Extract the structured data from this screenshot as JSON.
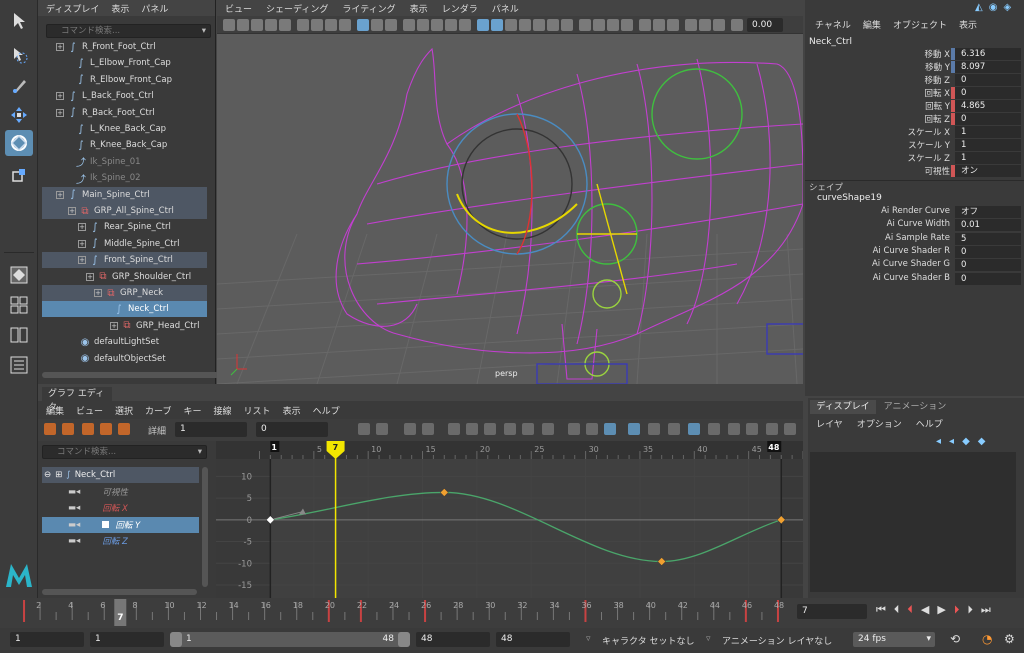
{
  "outliner": {
    "menu": [
      "ディスプレイ",
      "表示",
      "パネル"
    ],
    "search_placeholder": "コマンド検索...",
    "items": [
      {
        "label": "R_Front_Foot_Ctrl"
      },
      {
        "label": "L_Elbow_Front_Cap"
      },
      {
        "label": "R_Elbow_Front_Cap"
      },
      {
        "label": "L_Back_Foot_Ctrl"
      },
      {
        "label": "R_Back_Foot_Ctrl"
      },
      {
        "label": "L_Knee_Back_Cap"
      },
      {
        "label": "R_Knee_Back_Cap"
      },
      {
        "label": "Ik_Spine_01"
      },
      {
        "label": "Ik_Spine_02"
      },
      {
        "label": "Main_Spine_Ctrl"
      },
      {
        "label": "GRP_All_Spine_Ctrl"
      },
      {
        "label": "Rear_Spine_Ctrl"
      },
      {
        "label": "Middle_Spine_Ctrl"
      },
      {
        "label": "Front_Spine_Ctrl"
      },
      {
        "label": "GRP_Shoulder_Ctrl"
      },
      {
        "label": "GRP_Neck"
      },
      {
        "label": "Neck_Ctrl"
      },
      {
        "label": "GRP_Head_Ctrl"
      },
      {
        "label": "defaultLightSet"
      },
      {
        "label": "defaultObjectSet"
      }
    ]
  },
  "viewport": {
    "menu": [
      "ビュー",
      "シェーディング",
      "ライティング",
      "表示",
      "レンダラ",
      "パネル"
    ],
    "camera_label": "persp",
    "exposure_value": "0.00",
    "wire_color": "#c23fd0"
  },
  "attribute_editor": {
    "menu": [
      "チャネル",
      "編集",
      "オブジェクト",
      "表示"
    ],
    "object_name": "Neck_Ctrl",
    "channels": [
      {
        "label": "移動 X",
        "value": "6.316",
        "key": "#5a7aa8"
      },
      {
        "label": "移動 Y",
        "value": "8.097",
        "key": "#5a7aa8"
      },
      {
        "label": "移動 Z",
        "value": "0",
        "key": ""
      },
      {
        "label": "回転 X",
        "value": "0",
        "key": "#d05656"
      },
      {
        "label": "回転 Y",
        "value": "4.865",
        "key": "#d05656"
      },
      {
        "label": "回転 Z",
        "value": "0",
        "key": "#d05656"
      },
      {
        "label": "スケール X",
        "value": "1",
        "key": ""
      },
      {
        "label": "スケール Y",
        "value": "1",
        "key": ""
      },
      {
        "label": "スケール Z",
        "value": "1",
        "key": ""
      },
      {
        "label": "可視性",
        "value": "オン",
        "key": "#d05656"
      }
    ],
    "shapes_header": "シェイプ",
    "shape_name": "curveShape19",
    "shape_attrs": [
      {
        "label": "Ai Render Curve",
        "value": "オフ"
      },
      {
        "label": "Ai Curve Width",
        "value": "0.01"
      },
      {
        "label": "Ai Sample Rate",
        "value": "5"
      },
      {
        "label": "Ai Curve Shader R",
        "value": "0"
      },
      {
        "label": "Ai Curve Shader G",
        "value": "0"
      },
      {
        "label": "Ai Curve Shader B",
        "value": "0"
      }
    ]
  },
  "layer_panel": {
    "tabs": [
      "ディスプレイ",
      "アニメーション"
    ],
    "menu": [
      "レイヤ",
      "オプション",
      "ヘルプ"
    ]
  },
  "graph_editor": {
    "title": "グラフ エディタ",
    "menu": [
      "編集",
      "ビュー",
      "選択",
      "カーブ",
      "キー",
      "接線",
      "リスト",
      "表示",
      "ヘルプ"
    ],
    "detail_label": "詳細",
    "detail_field1": "1",
    "detail_field2": "0",
    "search_placeholder": "コマンド検索...",
    "curve_items": [
      {
        "label": "Neck_Ctrl",
        "style": "node"
      },
      {
        "label": "可視性",
        "style": "dim"
      },
      {
        "label": "回転 X",
        "style": "red"
      },
      {
        "label": "回転 Y",
        "style": "sel"
      },
      {
        "label": "回転 Z",
        "style": "blue"
      }
    ],
    "frame_ticks": [
      5,
      10,
      15,
      20,
      25,
      30,
      35,
      40,
      45
    ],
    "start_frame": "1",
    "end_frame": "48",
    "current_frame": "7",
    "value_ticks": [
      10,
      5,
      0,
      -5,
      -10,
      -15
    ]
  },
  "chart_data": {
    "type": "line",
    "title": "",
    "xlabel": "",
    "ylabel": "",
    "xlim": [
      0,
      49
    ],
    "ylim": [
      -18,
      14
    ],
    "series": [
      {
        "name": "回転 Y",
        "color": "#4aa56a",
        "keys": [
          [
            1,
            0
          ],
          [
            17,
            6.3
          ],
          [
            37,
            -9.6
          ],
          [
            48,
            0
          ]
        ]
      }
    ]
  },
  "time_slider": {
    "ticks": [
      2,
      4,
      6,
      8,
      10,
      12,
      14,
      16,
      18,
      20,
      22,
      24,
      26,
      28,
      30,
      32,
      34,
      36,
      38,
      40,
      42,
      44,
      46,
      48
    ],
    "current_frame": "7",
    "current_field": "7"
  },
  "range_slider": {
    "start": "1",
    "start_inner": "1",
    "range_left": "1",
    "range_right": "48",
    "end_inner": "48",
    "end": "48",
    "character_set": "キャラクタ セットなし",
    "anim_layer": "アニメーション レイヤなし",
    "fps": "24 fps"
  }
}
